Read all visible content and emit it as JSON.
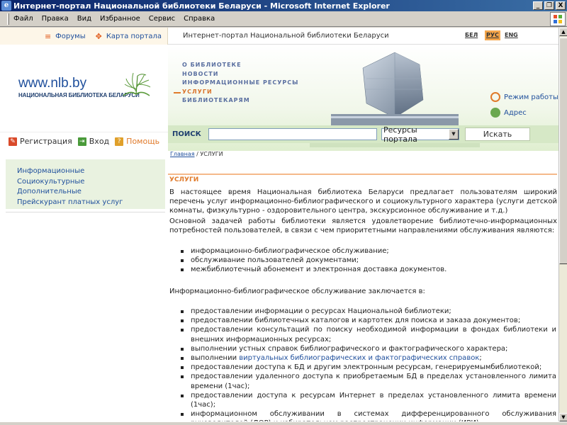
{
  "window": {
    "title": "Интернет-портал Национальной библиотеки Беларуси - Microsoft Internet Explorer",
    "buttons": [
      "_",
      "❐",
      "X"
    ]
  },
  "menubar": {
    "items": [
      "Файл",
      "Правка",
      "Вид",
      "Избранное",
      "Сервис",
      "Справка"
    ]
  },
  "topstrip": {
    "forums": "Форумы",
    "sitemap": "Карта портала",
    "portal_title": "Интернет-портал Национальной библиотеки Беларуси",
    "languages": [
      {
        "code": "БЕЛ",
        "active": false
      },
      {
        "code": "РУС",
        "active": true
      },
      {
        "code": "ENG",
        "active": false
      }
    ]
  },
  "header": {
    "url": "www.nlb.by",
    "name": "НАЦИОНАЛЬНАЯ БИБЛИОТЕКА БЕЛАРУСИ",
    "nav": [
      {
        "label": "О БИБЛИОТЕКЕ",
        "active": false
      },
      {
        "label": "НОВОСТИ",
        "active": false
      },
      {
        "label": "ИНФОРМАЦИОННЫЕ РЕСУРСЫ",
        "active": false
      },
      {
        "label": "УСЛУГИ",
        "active": true
      },
      {
        "label": "БИБЛИОТЕКАРЯМ",
        "active": false
      }
    ],
    "side_links": [
      "Режим работы",
      "Адрес"
    ]
  },
  "userbar": {
    "register": "Регистрация",
    "login": "Вход",
    "help": "Помощь"
  },
  "search": {
    "label": "ПОИСК",
    "input_value": "",
    "select_value": "Ресурсы портала",
    "button": "Искать"
  },
  "sidebar": {
    "items": [
      "Информационные",
      "Социокультурные",
      "Дополнительные",
      "Прейскурант платных услуг"
    ]
  },
  "content": {
    "breadcrumb_home": "Главная",
    "breadcrumb_sep": " / ",
    "breadcrumb_current": "УСЛУГИ",
    "section_title": "УСЛУГИ",
    "intro": "В настоящее время Национальная библиотека Беларуси предлагает пользователям широкий перечень услуг информационно-библиографического и социокультурного характера (услуги детской комнаты, физкультурно - оздоровительного центра, экскурсионное обслуживание и т.д.)",
    "intro2": "Основной задачей работы библиотеки является удовлетворение библиотечно-информационных потребностей пользователей, в связи с чем приоритетными направлениями обслуживания являются:",
    "priorities": [
      "информационно-библиографическое обслуживание;",
      "обслуживание пользователей документами;",
      "межбиблиотечный абонемент и электронная доставка документов."
    ],
    "info_intro": "Информационно-библиографическое обслуживание заключается в:",
    "info_items": {
      "i0": "предоставлении информации о ресурсах Национальной библиотеки;",
      "i1": "предоставлении библиотечных каталогов и картотек для поиска и заказа документов;",
      "i2": "предоставлении консультаций по поиску необходимой информации в фондах библиотеки и внешних информационных ресурсах;",
      "i3": "выполнении устных справок библиографического и фактографического характера;",
      "i4_prefix": "выполнении ",
      "i4_link": "виртуальных библиографических и фактографических справок",
      "i4_suffix": ";",
      "i5": "предоставлении доступа к БД и другим электронным ресурсам, генерируемымбиблиотекой;",
      "i6": "предоставлении удаленного доступа к приобретаемым БД в пределах установленного лимита времени (1час);",
      "i7": "предоставлении доступа к ресурсам Интернет в пределах установленного лимита времени (1час);",
      "i8": "информационном обслуживании в системах дифференцированного обслуживания руководителей (ДОР) и избирательном распространении информации (ИРИ)."
    }
  },
  "colors": {
    "link": "#1f4f9c",
    "accent_orange": "#e07a2a",
    "search_green": "#d6e8c6",
    "sidebar_green": "#e9f2e0"
  }
}
